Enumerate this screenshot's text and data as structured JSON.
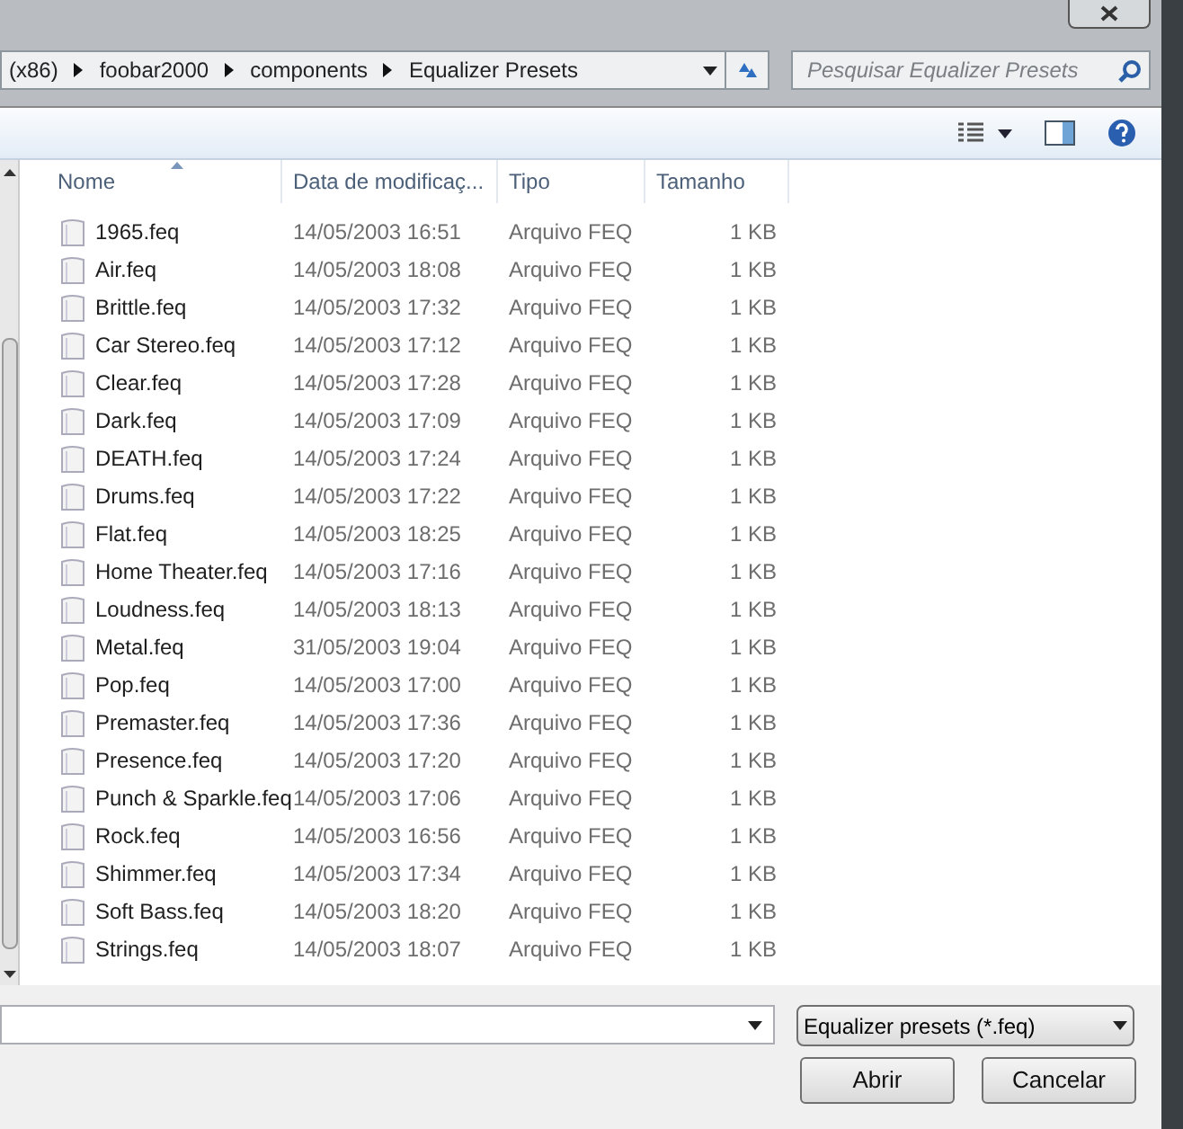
{
  "breadcrumb": [
    "(x86)",
    "foobar2000",
    "components",
    "Equalizer Presets"
  ],
  "search": {
    "placeholder": "Pesquisar Equalizer Presets"
  },
  "columns": [
    "Nome",
    "Data de modificaç...",
    "Tipo",
    "Tamanho"
  ],
  "files": [
    {
      "name": "1965.feq",
      "date": "14/05/2003 16:51",
      "type": "Arquivo FEQ",
      "size": "1 KB"
    },
    {
      "name": "Air.feq",
      "date": "14/05/2003 18:08",
      "type": "Arquivo FEQ",
      "size": "1 KB"
    },
    {
      "name": "Brittle.feq",
      "date": "14/05/2003 17:32",
      "type": "Arquivo FEQ",
      "size": "1 KB"
    },
    {
      "name": "Car Stereo.feq",
      "date": "14/05/2003 17:12",
      "type": "Arquivo FEQ",
      "size": "1 KB"
    },
    {
      "name": "Clear.feq",
      "date": "14/05/2003 17:28",
      "type": "Arquivo FEQ",
      "size": "1 KB"
    },
    {
      "name": "Dark.feq",
      "date": "14/05/2003 17:09",
      "type": "Arquivo FEQ",
      "size": "1 KB"
    },
    {
      "name": "DEATH.feq",
      "date": "14/05/2003 17:24",
      "type": "Arquivo FEQ",
      "size": "1 KB"
    },
    {
      "name": "Drums.feq",
      "date": "14/05/2003 17:22",
      "type": "Arquivo FEQ",
      "size": "1 KB"
    },
    {
      "name": "Flat.feq",
      "date": "14/05/2003 18:25",
      "type": "Arquivo FEQ",
      "size": "1 KB"
    },
    {
      "name": "Home Theater.feq",
      "date": "14/05/2003 17:16",
      "type": "Arquivo FEQ",
      "size": "1 KB"
    },
    {
      "name": "Loudness.feq",
      "date": "14/05/2003 18:13",
      "type": "Arquivo FEQ",
      "size": "1 KB"
    },
    {
      "name": "Metal.feq",
      "date": "31/05/2003 19:04",
      "type": "Arquivo FEQ",
      "size": "1 KB"
    },
    {
      "name": "Pop.feq",
      "date": "14/05/2003 17:00",
      "type": "Arquivo FEQ",
      "size": "1 KB"
    },
    {
      "name": "Premaster.feq",
      "date": "14/05/2003 17:36",
      "type": "Arquivo FEQ",
      "size": "1 KB"
    },
    {
      "name": "Presence.feq",
      "date": "14/05/2003 17:20",
      "type": "Arquivo FEQ",
      "size": "1 KB"
    },
    {
      "name": "Punch & Sparkle.feq",
      "date": "14/05/2003 17:06",
      "type": "Arquivo FEQ",
      "size": "1 KB"
    },
    {
      "name": "Rock.feq",
      "date": "14/05/2003 16:56",
      "type": "Arquivo FEQ",
      "size": "1 KB"
    },
    {
      "name": "Shimmer.feq",
      "date": "14/05/2003 17:34",
      "type": "Arquivo FEQ",
      "size": "1 KB"
    },
    {
      "name": "Soft Bass.feq",
      "date": "14/05/2003 18:20",
      "type": "Arquivo FEQ",
      "size": "1 KB"
    },
    {
      "name": "Strings.feq",
      "date": "14/05/2003 18:07",
      "type": "Arquivo FEQ",
      "size": "1 KB"
    }
  ],
  "file_type": "Equalizer presets (*.feq)",
  "buttons": [
    "Abrir",
    "Cancelar"
  ]
}
